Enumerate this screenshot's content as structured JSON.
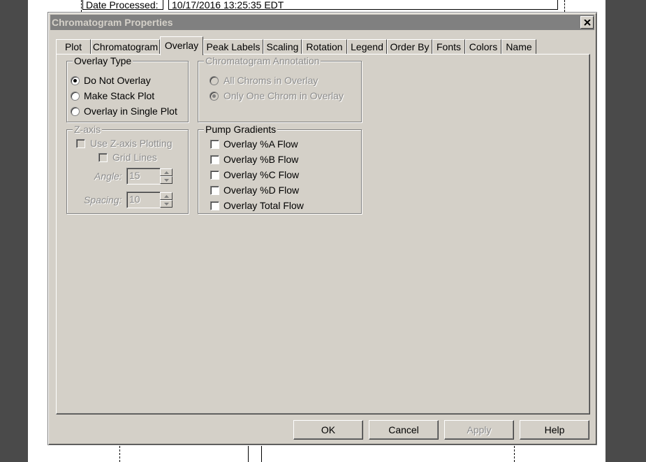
{
  "background": {
    "date_label": "Date Processed:",
    "date_value": "10/17/2016 13:25:35 EDT"
  },
  "dialog": {
    "title": "Chromatogram Properties",
    "close_glyph": "✕"
  },
  "tabs": [
    {
      "label": "Plot"
    },
    {
      "label": "Chromatogram"
    },
    {
      "label": "Overlay",
      "active": true
    },
    {
      "label": "Peak Labels"
    },
    {
      "label": "Scaling"
    },
    {
      "label": "Rotation"
    },
    {
      "label": "Legend"
    },
    {
      "label": "Order By"
    },
    {
      "label": "Fonts"
    },
    {
      "label": "Colors"
    },
    {
      "label": "Name"
    }
  ],
  "overlay_type": {
    "title": "Overlay Type",
    "options": [
      {
        "label": "Do Not Overlay",
        "selected": true
      },
      {
        "label": "Make Stack Plot",
        "selected": false
      },
      {
        "label": "Overlay in Single Plot",
        "selected": false
      }
    ]
  },
  "chrom_annotation": {
    "title": "Chromatogram Annotation",
    "enabled": false,
    "options": [
      {
        "label": "All Chroms in Overlay",
        "selected": false
      },
      {
        "label": "Only One Chrom in Overlay",
        "selected": true
      }
    ]
  },
  "z_axis": {
    "title": "Z-axis",
    "enabled": false,
    "use_label": "Use Z-axis Plotting",
    "grid_label": "Grid Lines",
    "angle_label": "Angle:",
    "angle_value": "15",
    "spacing_label": "Spacing:",
    "spacing_value": "10"
  },
  "pump_gradients": {
    "title": "Pump Gradients",
    "options": [
      {
        "label": "Overlay %A Flow",
        "checked": false
      },
      {
        "label": "Overlay %B Flow",
        "checked": false
      },
      {
        "label": "Overlay %C Flow",
        "checked": false
      },
      {
        "label": "Overlay %D Flow",
        "checked": false
      },
      {
        "label": "Overlay Total Flow",
        "checked": false
      }
    ]
  },
  "buttons": {
    "ok": "OK",
    "cancel": "Cancel",
    "apply": "Apply",
    "help": "Help"
  },
  "colors": {
    "dialog_face": "#d4d0c8",
    "titlebar_inactive": "#808080",
    "disabled_text": "#8c8c8c"
  }
}
